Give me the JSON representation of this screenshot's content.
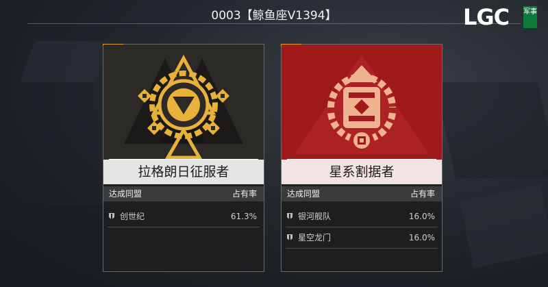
{
  "header": {
    "title": "0003【鲸鱼座V1394】"
  },
  "logo": {
    "text": "LGC",
    "badge": "军事"
  },
  "columns": {
    "ally": "达成同盟",
    "share": "占有率"
  },
  "cards": [
    {
      "name": "拉格朗日征服者",
      "theme": "gold",
      "colors": {
        "emblem": "#e8b23a",
        "background": "#2c2a27"
      },
      "rows": [
        {
          "ally": "创世纪",
          "share": "61.3%"
        }
      ]
    },
    {
      "name": "星系割据者",
      "theme": "red",
      "colors": {
        "emblem": "#f0b38f",
        "background": "#a01a1a"
      },
      "rows": [
        {
          "ally": "银河舰队",
          "share": "16.0%"
        },
        {
          "ally": "星空龙门",
          "share": "16.0%"
        }
      ]
    }
  ]
}
